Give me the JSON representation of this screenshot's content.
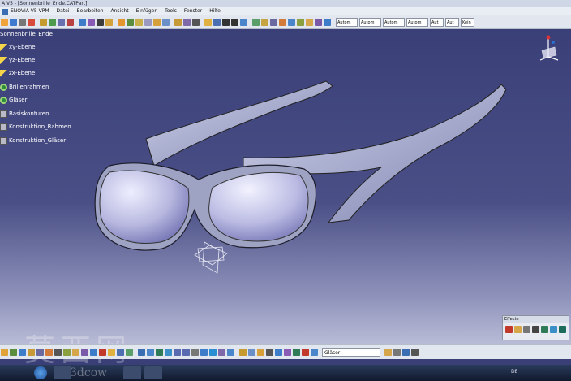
{
  "window": {
    "title": "A V5 - [Sonnenbrille_Ende.CATPart]"
  },
  "menu": {
    "logo": "ENOVIA V5 VPM",
    "items": [
      "Datei",
      "Bearbeiten",
      "Ansicht",
      "Einfügen",
      "Tools",
      "Fenster",
      "Hilfe"
    ]
  },
  "toolbar": {
    "combos": [
      "Autom",
      "Autom",
      "Autom",
      "Autom",
      "Aut",
      "Aut",
      "Kein"
    ]
  },
  "tree": {
    "root": "Sonnenbrille_Ende",
    "items": [
      {
        "label": "xy-Ebene",
        "icon": "plane-icon"
      },
      {
        "label": "yz-Ebene",
        "icon": "plane-icon"
      },
      {
        "label": "zx-Ebene",
        "icon": "plane-icon"
      },
      {
        "label": "Brillenrahmen",
        "icon": "body-icon"
      },
      {
        "label": "Gläser",
        "icon": "body-icon"
      },
      {
        "label": "Basiskonturen",
        "icon": "sketch-icon"
      },
      {
        "label": "Konstruktion_Rahmen",
        "icon": "sketch-icon"
      },
      {
        "label": "Konstruktion_Gläser",
        "icon": "sketch-icon"
      }
    ]
  },
  "effekte": {
    "title": "Effekte"
  },
  "bottom": {
    "selection": "Gläser"
  },
  "taskbar": {
    "lang": "DE"
  },
  "watermark": {
    "main": "莫西网",
    "sub": "3dcow"
  },
  "colors": {
    "viewport_top": "#3a3f78",
    "lens": "#c9c9ea",
    "frame": "#9ea3c4"
  }
}
